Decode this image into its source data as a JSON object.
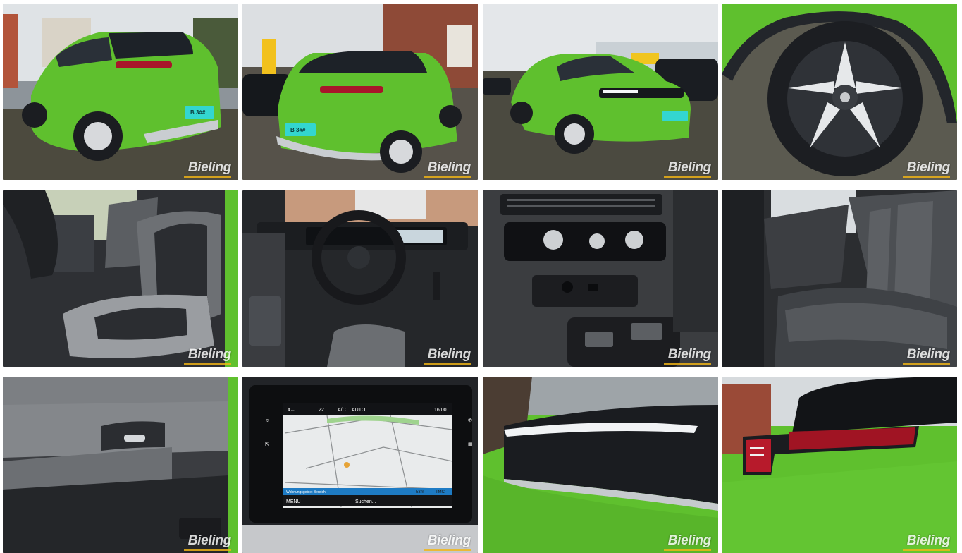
{
  "gallery": {
    "watermark": "Bieling",
    "plate_text": "B 3##",
    "display": {
      "status_left": "4←",
      "temp": "22",
      "ac": "A/C",
      "auto": "AUTO",
      "clock": "16:00",
      "route_text": "Wohnungsgebiet Bereich",
      "distance": "53m",
      "tmc": "TMC",
      "menu": "MENU",
      "search": "Suchen..."
    },
    "colors": {
      "body_green": "#5fc02e",
      "watermark_bar": "#f3b616",
      "plate": "#33d6d0"
    },
    "photos": [
      {
        "name": "rear-left-exterior"
      },
      {
        "name": "rear-exterior"
      },
      {
        "name": "front-left-exterior"
      },
      {
        "name": "wheel-rim"
      },
      {
        "name": "front-seat"
      },
      {
        "name": "cockpit-steering"
      },
      {
        "name": "climate-controls"
      },
      {
        "name": "rear-seats"
      },
      {
        "name": "door-panel"
      },
      {
        "name": "navigation-display"
      },
      {
        "name": "headlight"
      },
      {
        "name": "taillight"
      }
    ]
  }
}
